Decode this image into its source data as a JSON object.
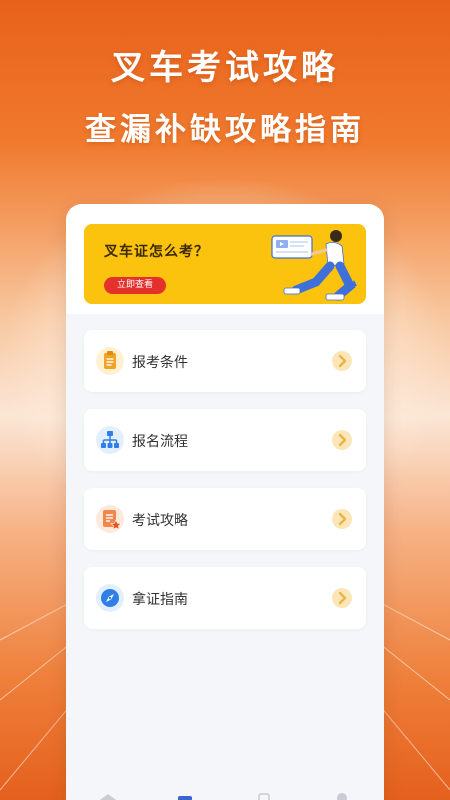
{
  "promo": {
    "title": "叉车考试攻略",
    "subtitle": "查漏补缺攻略指南"
  },
  "banner": {
    "question": "叉车证怎么考？",
    "button_label": "立即查看"
  },
  "menu": [
    {
      "label": "报考条件",
      "icon": "clipboard-list-icon"
    },
    {
      "label": "报名流程",
      "icon": "flowchart-icon"
    },
    {
      "label": "考试攻略",
      "icon": "document-star-icon"
    },
    {
      "label": "拿证指南",
      "icon": "compass-icon"
    }
  ],
  "colors": {
    "background_orange": "#e96a1f",
    "banner_yellow": "#fcc30e",
    "button_red": "#e5312c",
    "chevron_bg": "#fbe6b8",
    "chevron_fg": "#e8b548"
  }
}
